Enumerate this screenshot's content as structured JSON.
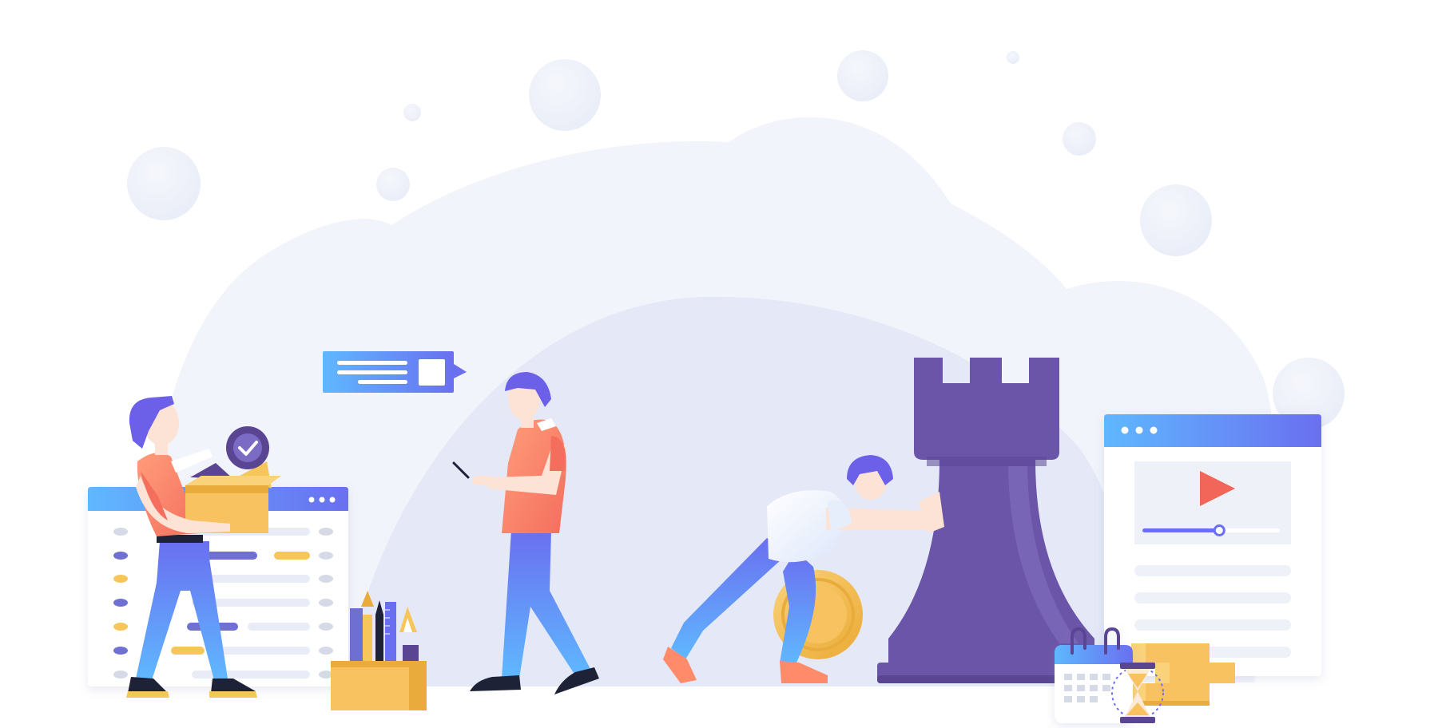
{
  "illustration": {
    "colors": {
      "background": "#ffffff",
      "cloud": "#F1F4FB",
      "cloud_inner": "#E3E7F6",
      "bubble": "#EEF1F8",
      "accent_blue": "#5FB8FF",
      "accent_indigo": "#6A6FF0",
      "rook": "#6B55A8",
      "rook_highlight": "#8270C0",
      "rook_shadow": "#5A4593",
      "shirt_coral": "#F46E5E",
      "shirt_peach": "#FF9D7A",
      "pants_blue": "#5B8BF5",
      "hair_purple": "#6C5FE8",
      "skin": "#FCE3D6",
      "box_gold": "#F7C25F",
      "box_gold_dark": "#E9AB3C",
      "coin_gold": "#F6C65A",
      "play_red": "#F2665A",
      "line_grey": "#E6E9F4",
      "dot_grey": "#D6DAE6",
      "dot_indigo": "#6F6FD2",
      "dot_yellow": "#F6C65A",
      "shoe_dark": "#1E2236",
      "shoe_coral": "#FF8B6B"
    },
    "elements": {
      "cloud": "background-cloud",
      "bubbles": "decorative-bubbles",
      "list_window": "task-list-window",
      "box_person": "person-carrying-box",
      "check_badge": "checkmark-badge-icon",
      "chat_bubble": "chat-message-bubble",
      "phone_person": "person-using-phone",
      "supplies_box": "office-supplies-box",
      "push_person": "person-pushing-rook",
      "coin": "dollar-coin-icon",
      "rook": "chess-rook",
      "video_window": "video-player-window",
      "play_icon": "play-icon",
      "calendar": "calendar-icon",
      "hourglass": "hourglass-icon",
      "gold_bars": "gold-bars-stack"
    },
    "video_progress": 0.56
  }
}
